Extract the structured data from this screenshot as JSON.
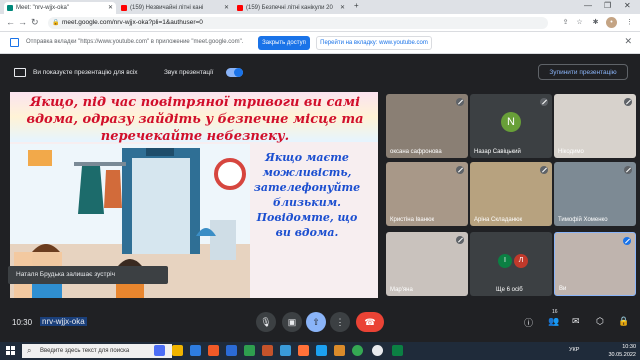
{
  "browser": {
    "tabs": [
      {
        "label": "Meet: \"nrv-wjjx-oka\"",
        "active": true,
        "favicon_color": "#00897b"
      },
      {
        "label": "(159) Незвичайні літні кані",
        "active": false,
        "favicon_color": "#ff0000"
      },
      {
        "label": "(159) Безпечні літні канікули 20",
        "active": false,
        "favicon_color": "#ff0000"
      }
    ],
    "new_tab": "+",
    "url": "meet.google.com/nrv-wjjx-oka?pli=1&authuser=0"
  },
  "infobar": {
    "text": "Отправка вкладки \"https://www.youtube.com\" в приложение \"meet.google.com\".",
    "share_button": "Закрыть доступ",
    "switch_button": "Перейти на вкладку: www.youtube.com"
  },
  "meet": {
    "presenting_text": "Ви показуєте презентацію для всіх",
    "sound_label": "Звук презентації",
    "sound_on": true,
    "stop_button": "Зупинити презентацію",
    "left_notice": "Наталя Брудька залишає зустріч",
    "time": "10:30",
    "meeting_code": "nrv-wjjx-oka",
    "participants_badge": "16"
  },
  "slide": {
    "title": "Якщо, під час повітряної тривоги ви самі вдома, одразу зайдіть у безпечне місце та перечекайте небезпеку.",
    "body": "Якщо маєте можливість, зателефонуйте близьким. Повідомте, що ви вдома."
  },
  "participants": [
    {
      "name": "оксана сафронова",
      "kind": "video"
    },
    {
      "name": "Назар Савіцький",
      "kind": "avatar",
      "initial": "N",
      "color": "#689f38"
    },
    {
      "name": "Нікодимо",
      "kind": "video"
    },
    {
      "name": "Кристіна Іванюк",
      "kind": "video"
    },
    {
      "name": "Аріна Складанюк",
      "kind": "video"
    },
    {
      "name": "Тимофій Хоменко",
      "kind": "video"
    },
    {
      "name": "Мар'яна",
      "kind": "video"
    },
    {
      "name": "Ще 6 осіб",
      "kind": "more"
    },
    {
      "name": "Ви",
      "kind": "self"
    }
  ],
  "taskbar": {
    "search_placeholder": "Введите здесь текст для поиска",
    "lang": "УКР",
    "time": "10:30",
    "date": "30.05.2022"
  }
}
